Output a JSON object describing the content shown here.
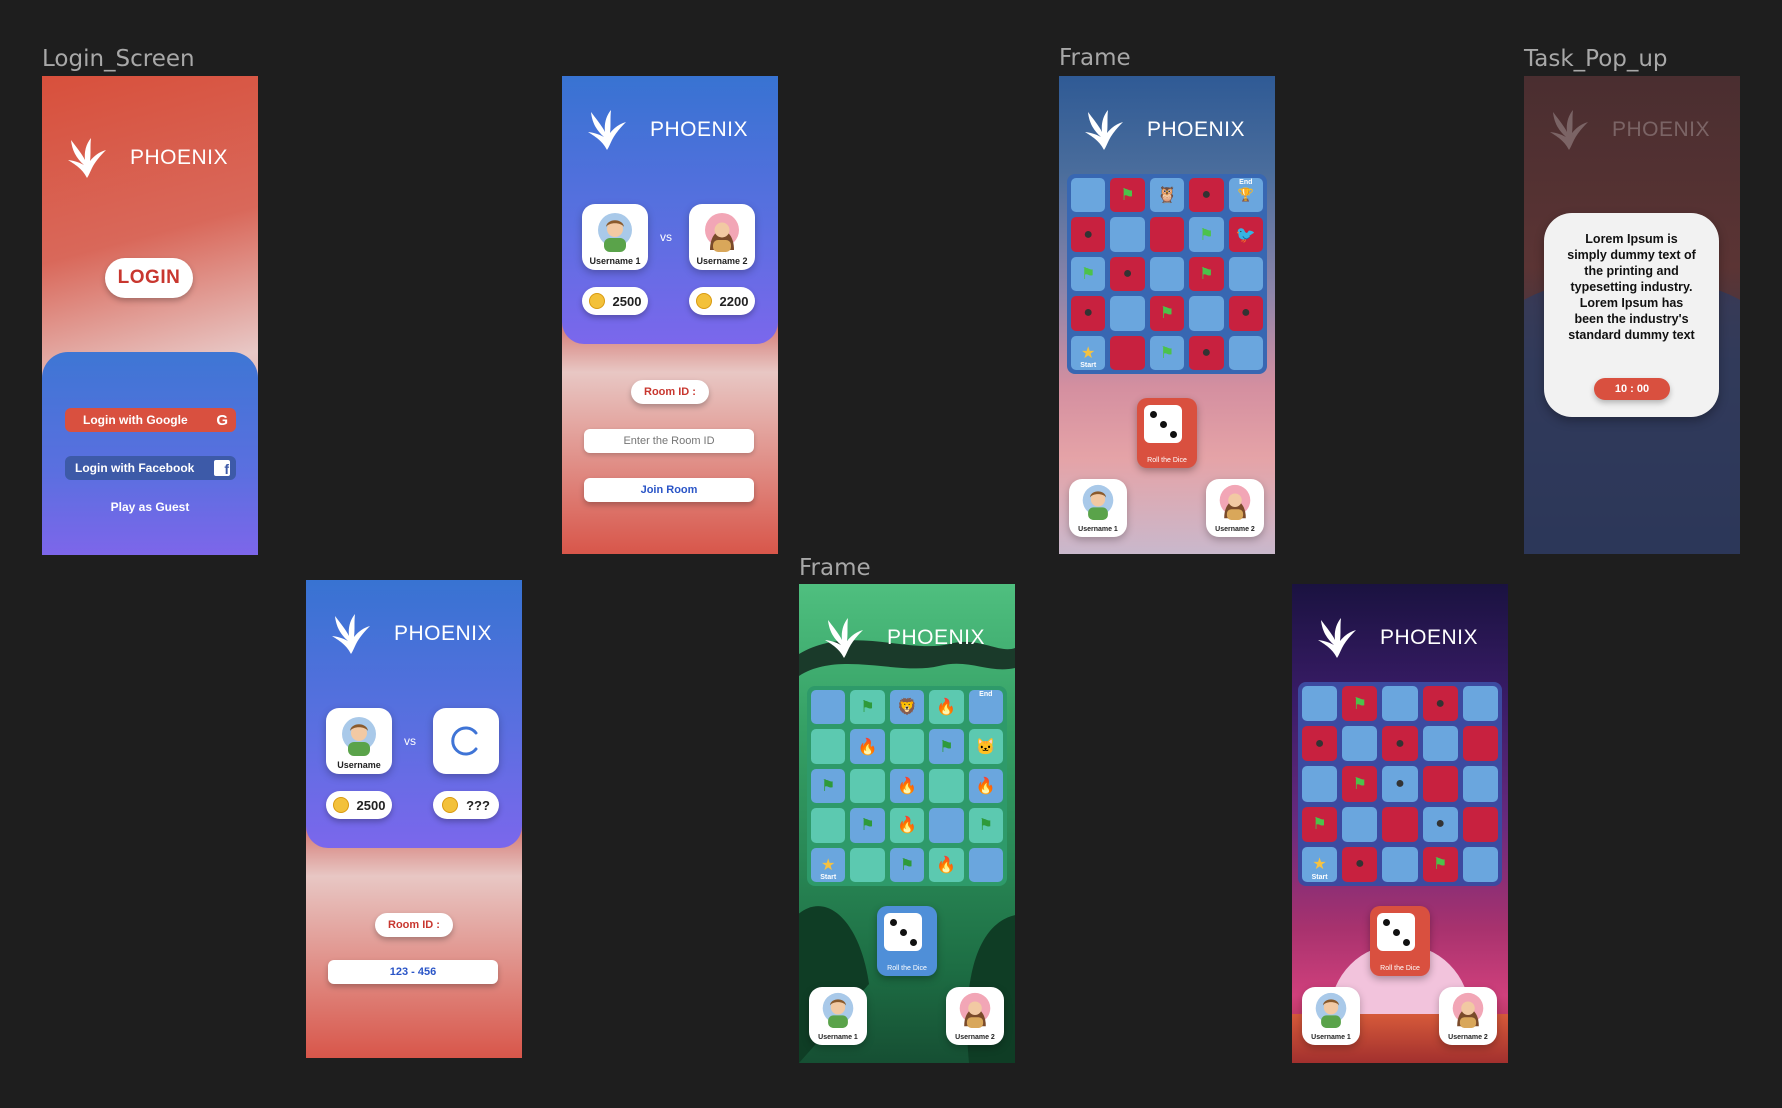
{
  "labels": {
    "login_screen": "Login_Screen",
    "frame": "Frame",
    "task_popup": "Task_Pop_up"
  },
  "brand": "PHOENIX",
  "login": {
    "login_button": "LOGIN",
    "google": "Login with Google",
    "facebook": "Login with Facebook",
    "guest": "Play as Guest"
  },
  "lobby_join": {
    "player1": "Username 1",
    "player2": "Username 2",
    "vs": "vs",
    "coins1": "2500",
    "coins2": "2200",
    "room_label": "Room ID :",
    "room_placeholder": "Enter the Room ID",
    "join": "Join Room"
  },
  "lobby_wait": {
    "player": "Username",
    "vs": "vs",
    "coins1": "2500",
    "coins2": "???",
    "room_label": "Room ID :",
    "room_value": "123 - 456"
  },
  "game": {
    "roll": "Roll the Dice",
    "player1": "Username 1",
    "player2": "Username 2",
    "start": "Start",
    "end": "End"
  },
  "popup": {
    "text": "Lorem Ipsum is simply dummy text of the printing and typesetting industry. Lorem Ipsum has been the industry's standard dummy text",
    "timer": "10 : 00"
  },
  "colors": {
    "canvas": "#1e1e1e",
    "accent_red": "#d9503f",
    "accent_blue": "#3f74d6",
    "purple": "#7b68ee",
    "tile_blue": "#6aa6de",
    "tile_red": "#c8213f",
    "tile_green": "#5cc9b0"
  }
}
